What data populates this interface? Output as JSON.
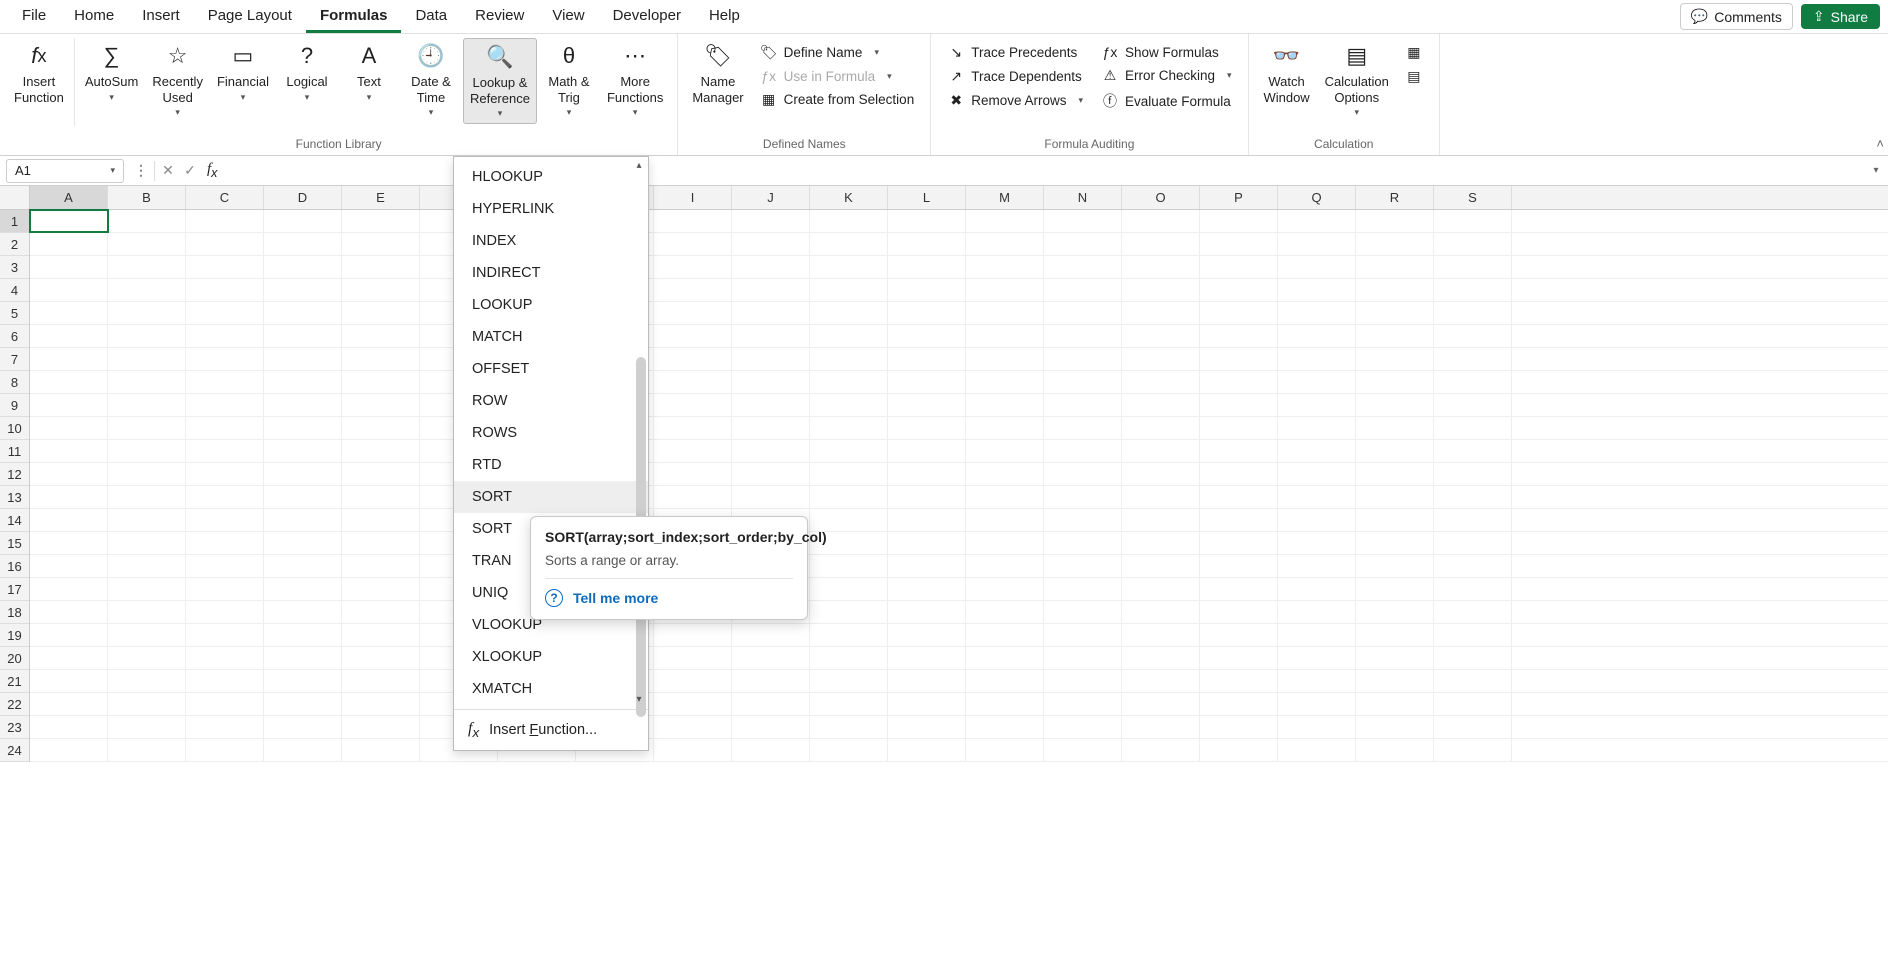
{
  "tabs": [
    "File",
    "Home",
    "Insert",
    "Page Layout",
    "Formulas",
    "Data",
    "Review",
    "View",
    "Developer",
    "Help"
  ],
  "active_tab": "Formulas",
  "top_right": {
    "comments": "Comments",
    "share": "Share"
  },
  "ribbon": {
    "function_library": {
      "label": "Function Library",
      "insert_function": "Insert\nFunction",
      "autosum": "AutoSum",
      "recently_used": "Recently\nUsed",
      "financial": "Financial",
      "logical": "Logical",
      "text": "Text",
      "date_time": "Date &\nTime",
      "lookup_reference": "Lookup &\nReference",
      "math_trig": "Math &\nTrig",
      "more_functions": "More\nFunctions"
    },
    "defined_names": {
      "label": "Defined Names",
      "name_manager": "Name\nManager",
      "define_name": "Define Name",
      "use_in_formula": "Use in Formula",
      "create_selection": "Create from Selection"
    },
    "formula_auditing": {
      "label": "Formula Auditing",
      "trace_precedents": "Trace Precedents",
      "trace_dependents": "Trace Dependents",
      "remove_arrows": "Remove Arrows",
      "show_formulas": "Show Formulas",
      "error_checking": "Error Checking",
      "evaluate_formula": "Evaluate Formula"
    },
    "calculation": {
      "label": "Calculation",
      "watch_window": "Watch\nWindow",
      "calc_options": "Calculation\nOptions"
    }
  },
  "formula_bar": {
    "namebox": "A1",
    "formula": ""
  },
  "columns": [
    "A",
    "B",
    "C",
    "D",
    "E",
    "",
    "",
    "",
    "I",
    "J",
    "K",
    "L",
    "M",
    "N",
    "O",
    "P",
    "Q",
    "R",
    "S"
  ],
  "rows": [
    "1",
    "2",
    "3",
    "4",
    "5",
    "6",
    "7",
    "8",
    "9",
    "10",
    "11",
    "12",
    "13",
    "14",
    "15",
    "16",
    "17",
    "18",
    "19",
    "20",
    "21",
    "22",
    "23",
    "24"
  ],
  "dropdown": {
    "items": [
      "HLOOKUP",
      "HYPERLINK",
      "INDEX",
      "INDIRECT",
      "LOOKUP",
      "MATCH",
      "OFFSET",
      "ROW",
      "ROWS",
      "RTD",
      "SORT",
      "SORTBY",
      "TRANSPOSE",
      "UNIQUE",
      "VLOOKUP",
      "XLOOKUP",
      "XMATCH"
    ],
    "truncated": {
      "11": "SORT",
      "12": "TRAN",
      "13": "UNIQ"
    },
    "hover_index": 10,
    "footer_prefix": "Insert ",
    "footer_uword": "F",
    "footer_rest": "unction..."
  },
  "tooltip": {
    "title": "SORT(array;sort_index;sort_order;by_col)",
    "desc": "Sorts a range or array.",
    "link": "Tell me more"
  }
}
